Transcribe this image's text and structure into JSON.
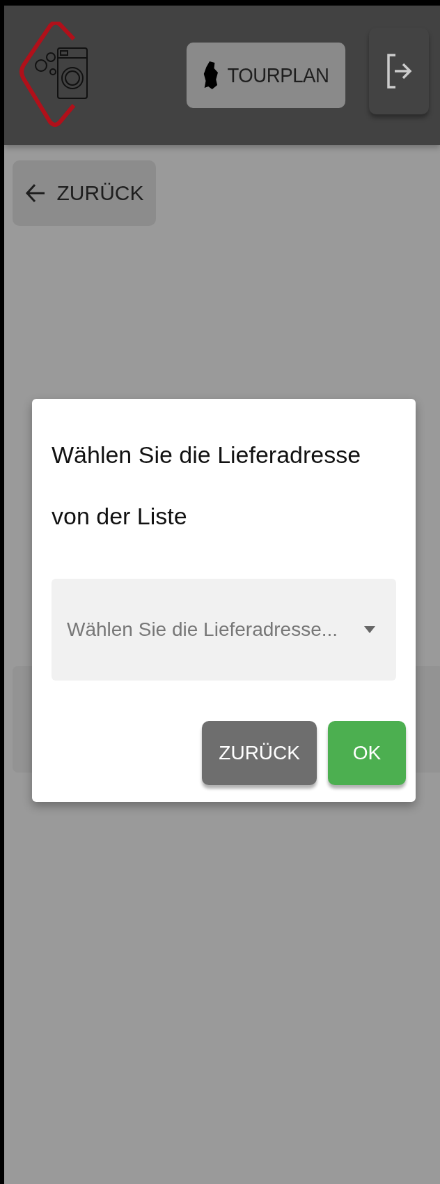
{
  "header": {
    "tourplan_button": "TOURPLAN"
  },
  "back_button": "ZURÜCK",
  "dialog": {
    "title": "Wählen Sie die Lieferadresse von der Liste",
    "select": {
      "placeholder": "Wählen Sie die Lieferadresse..."
    },
    "buttons": [
      {
        "label": "ZURÜCK",
        "kind": "secondary"
      },
      {
        "label": "OK",
        "kind": "primary"
      }
    ]
  }
}
